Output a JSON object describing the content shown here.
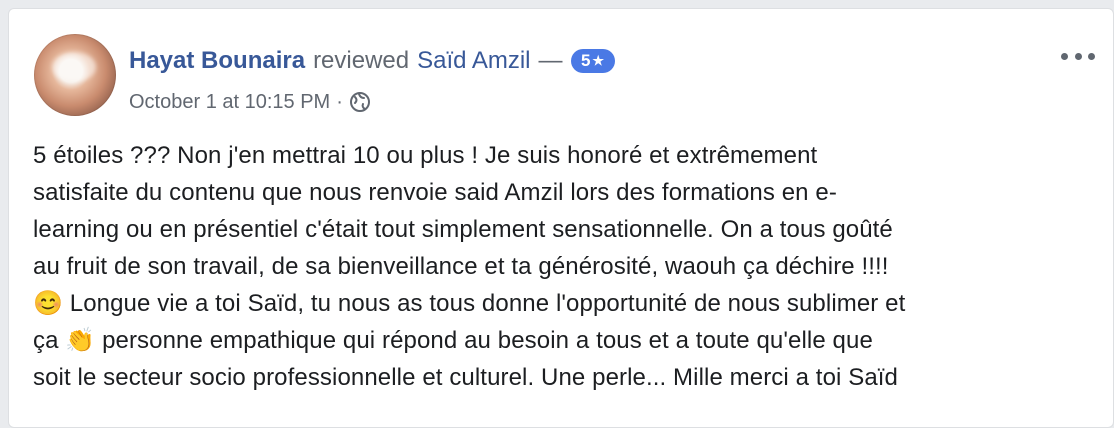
{
  "post": {
    "author_name": "Hayat Bounaira",
    "action_text": "reviewed",
    "page_name": "Saïd Amzil",
    "dash": "—",
    "rating_value": "5",
    "rating_star": "★",
    "timestamp": "October 1 at 10:15 PM",
    "dot": "·",
    "audience_icon": "globe-icon",
    "more_icon": "more-options-icon",
    "text_lines": [
      "5 étoiles ??? Non j'en mettrai 10 ou plus ! Je suis honoré et extrêmement",
      "satisfaite du contenu que nous renvoie said Amzil lors des formations en e-",
      "learning ou en présentiel c'était tout simplement sensationnelle. On a tous goûté",
      "au fruit de son travail, de sa bienveillance et ta générosité, waouh ça déchire !!!!",
      "😊 Longue vie a toi Saïd, tu nous as tous donne l'opportunité de nous sublimer et",
      "ça 👏 personne empathique qui répond au besoin a tous et a toute qu'elle que",
      "soit le secteur socio professionnelle et culturel. Une perle... Mille merci a toi Saïd"
    ]
  },
  "colors": {
    "link": "#385898",
    "meta": "#616770",
    "badge": "#4a79e5",
    "text": "#1c1e21",
    "background": "#e9ebee"
  }
}
